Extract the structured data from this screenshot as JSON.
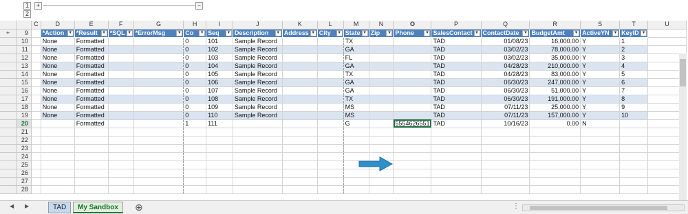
{
  "outline": {
    "levels": [
      "1",
      "2"
    ],
    "plus": "+",
    "minus": "−"
  },
  "columns": [
    "C",
    "D",
    "E",
    "F",
    "G",
    "H",
    "I",
    "J",
    "K",
    "L",
    "M",
    "N",
    "O",
    "P",
    "Q",
    "R",
    "S",
    "T",
    "U"
  ],
  "selected_column": "O",
  "header_row_num": "9",
  "headers": [
    "*Action",
    "*Result",
    "*SQL",
    "*ErrorMsg",
    "Co",
    "Seq",
    "Description",
    "Address",
    "City",
    "State",
    "Zip",
    "Phone",
    "SalesContact",
    "ContactDate",
    "BudgetAmt",
    "ActiveYN",
    "KeyID"
  ],
  "rows": [
    {
      "n": "10",
      "cells": [
        "None",
        "Formatted",
        "",
        "",
        "0",
        "101",
        "Sample Record",
        "",
        "",
        "TX",
        "",
        "",
        "TAD",
        "01/08/23",
        "16,000.00",
        "Y",
        "1"
      ]
    },
    {
      "n": "11",
      "cells": [
        "None",
        "Formatted",
        "",
        "",
        "0",
        "102",
        "Sample Record",
        "",
        "",
        "GA",
        "",
        "",
        "TAD",
        "03/02/23",
        "78,000.00",
        "Y",
        "2"
      ]
    },
    {
      "n": "12",
      "cells": [
        "None",
        "Formatted",
        "",
        "",
        "0",
        "103",
        "Sample Record",
        "",
        "",
        "FL",
        "",
        "",
        "TAD",
        "03/02/23",
        "35,000.00",
        "Y",
        "3"
      ]
    },
    {
      "n": "13",
      "cells": [
        "None",
        "Formatted",
        "",
        "",
        "0",
        "104",
        "Sample Record",
        "",
        "",
        "GA",
        "",
        "",
        "TAD",
        "04/28/23",
        "210,000.00",
        "Y",
        "4"
      ]
    },
    {
      "n": "14",
      "cells": [
        "None",
        "Formatted",
        "",
        "",
        "0",
        "105",
        "Sample Record",
        "",
        "",
        "TX",
        "",
        "",
        "TAD",
        "04/28/23",
        "83,000.00",
        "Y",
        "5"
      ]
    },
    {
      "n": "15",
      "cells": [
        "None",
        "Formatted",
        "",
        "",
        "0",
        "106",
        "Sample Record",
        "",
        "",
        "GA",
        "",
        "",
        "TAD",
        "06/30/23",
        "247,000.00",
        "Y",
        "6"
      ]
    },
    {
      "n": "16",
      "cells": [
        "None",
        "Formatted",
        "",
        "",
        "0",
        "107",
        "Sample Record",
        "",
        "",
        "GA",
        "",
        "",
        "TAD",
        "06/30/23",
        "51,000.00",
        "Y",
        "7"
      ]
    },
    {
      "n": "17",
      "cells": [
        "None",
        "Formatted",
        "",
        "",
        "0",
        "108",
        "Sample Record",
        "",
        "",
        "TX",
        "",
        "",
        "TAD",
        "06/30/23",
        "191,000.00",
        "Y",
        "8"
      ]
    },
    {
      "n": "18",
      "cells": [
        "None",
        "Formatted",
        "",
        "",
        "0",
        "109",
        "Sample Record",
        "",
        "",
        "MS",
        "",
        "",
        "TAD",
        "07/11/23",
        "25,000.00",
        "Y",
        "9"
      ]
    },
    {
      "n": "19",
      "cells": [
        "None",
        "Formatted",
        "",
        "",
        "0",
        "110",
        "Sample Record",
        "",
        "",
        "MS",
        "",
        "",
        "TAD",
        "07/11/23",
        "157,000.00",
        "Y",
        "10"
      ]
    },
    {
      "n": "20",
      "cells": [
        "",
        "Formatted",
        "",
        "",
        "1",
        "111",
        "",
        "",
        "",
        "G",
        "",
        "5554626551",
        "TAD",
        "10/16/23",
        "0.00",
        "N",
        ""
      ]
    }
  ],
  "empty_rows": [
    "21",
    "22",
    "23",
    "24",
    "25",
    "26",
    "27",
    "28"
  ],
  "tabs": [
    {
      "label": "TAD",
      "active": false
    },
    {
      "label": "My Sandbox",
      "active": true
    }
  ],
  "add_sheet": "⊕",
  "nav_prev": "◀",
  "nav_next": "▶",
  "colors": {
    "header_blue": "#4f81bd",
    "band": "#dbe5f1",
    "arrow": "#2f8fc9",
    "tab_active": "#e2f0d9",
    "tab_inactive": "#c5d9f1"
  }
}
